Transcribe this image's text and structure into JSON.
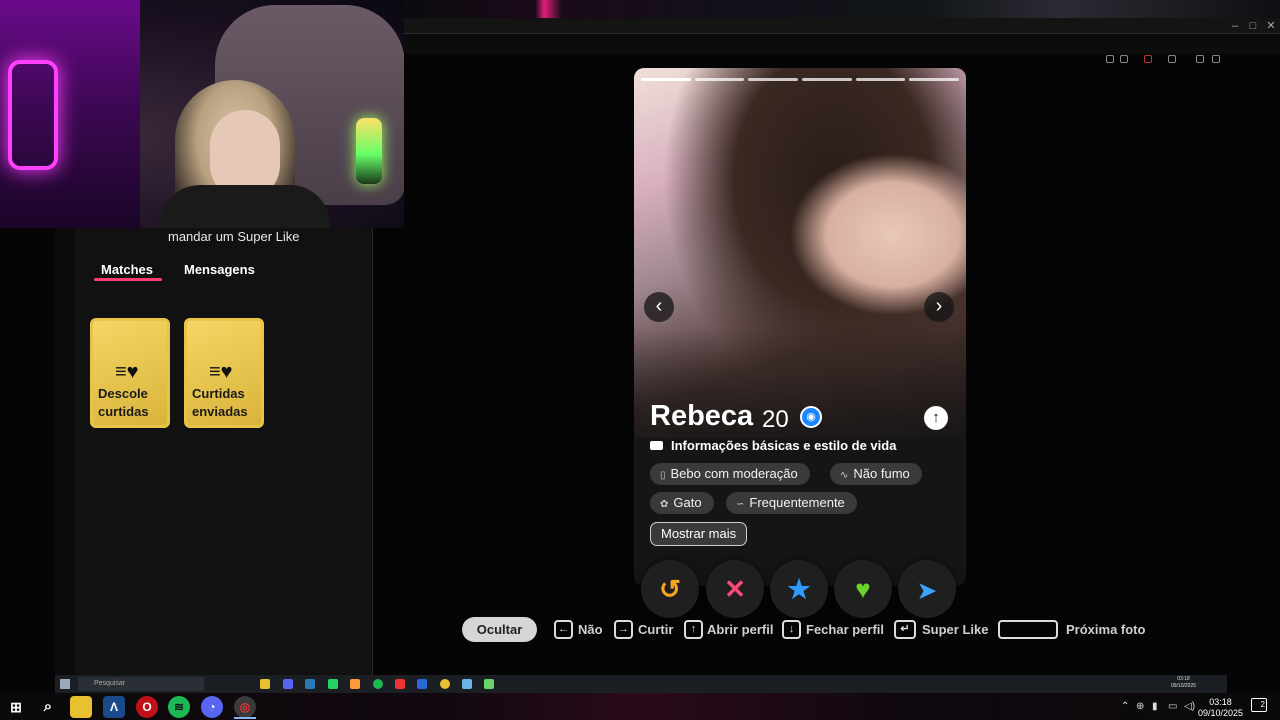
{
  "left_panel": {
    "super_like_hint": "mandar um Super Like",
    "tabs": [
      {
        "label": "Matches",
        "active": true
      },
      {
        "label": "Mensagens",
        "active": false
      }
    ],
    "cards": [
      {
        "line1": "Descole",
        "line2": "curtidas",
        "icon": "hearts-icon"
      },
      {
        "line1": "Curtidas",
        "line2": "enviadas",
        "icon": "hearts-icon"
      }
    ]
  },
  "profile": {
    "name": "Rebeca",
    "age": "20",
    "verified": true,
    "photo_count": 6,
    "current_photo": 1,
    "info_heading": "Informações básicas e estilo de vida",
    "chips": [
      {
        "label": "Bebo com moderação",
        "icon": "drink-icon"
      },
      {
        "label": "Não fumo",
        "icon": "smoking-icon"
      },
      {
        "label": "Gato",
        "icon": "pet-icon"
      },
      {
        "label": "Frequentemente",
        "icon": "workout-icon"
      }
    ],
    "show_more": "Mostrar mais"
  },
  "actions": [
    {
      "name": "rewind",
      "glyph": "↺",
      "color": "#f5a623"
    },
    {
      "name": "nope",
      "glyph": "✕",
      "color": "#fe4a7a"
    },
    {
      "name": "super-like",
      "glyph": "★",
      "color": "#2f9bff"
    },
    {
      "name": "like",
      "glyph": "♥",
      "color": "#6ad42a"
    },
    {
      "name": "boost",
      "glyph": "➤",
      "color": "#3aa3ff"
    }
  ],
  "hints": {
    "hide": "Ocultar",
    "items": [
      {
        "key": "←",
        "label": "Não"
      },
      {
        "key": "→",
        "label": "Curtir"
      },
      {
        "key": "↑",
        "label": "Abrir perfil"
      },
      {
        "key": "↓",
        "label": "Fechar perfil"
      },
      {
        "key": "↵",
        "label": "Super Like"
      },
      {
        "key": "",
        "label": "Próxima foto"
      }
    ]
  },
  "inner_taskbar": {
    "search_placeholder": "Pesquisar",
    "time": "03:18",
    "date": "09/10/2025"
  },
  "taskbar": {
    "time": "03:18",
    "date": "09/10/2025",
    "notifications": "2"
  },
  "colors": {
    "accent": "#fe3c72",
    "gold": "#e7c348"
  }
}
